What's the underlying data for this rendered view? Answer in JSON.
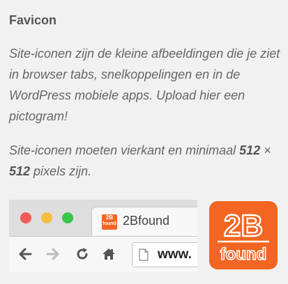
{
  "section": {
    "title": "Favicon",
    "description": "Site-iconen zijn de kleine afbeeldingen die je ziet in browser tabs, snelkoppelingen en in de WordPress mobiele apps. Upload hier een pictogram!",
    "req_prefix": "Site-iconen moeten vierkant en minimaal ",
    "req_size1": "512",
    "req_times": " × ",
    "req_size2": "512",
    "req_suffix": " pixels zijn."
  },
  "preview": {
    "tab_label": "2Bfound",
    "url_text": "www.",
    "favicon_line1": "2B",
    "favicon_line2": "found",
    "logo_line1": "2B",
    "logo_line2": "found",
    "colors": {
      "brand_orange": "#f26522",
      "close": "#f25a55",
      "minimize": "#f6be3b",
      "maximize": "#37c74a"
    }
  }
}
